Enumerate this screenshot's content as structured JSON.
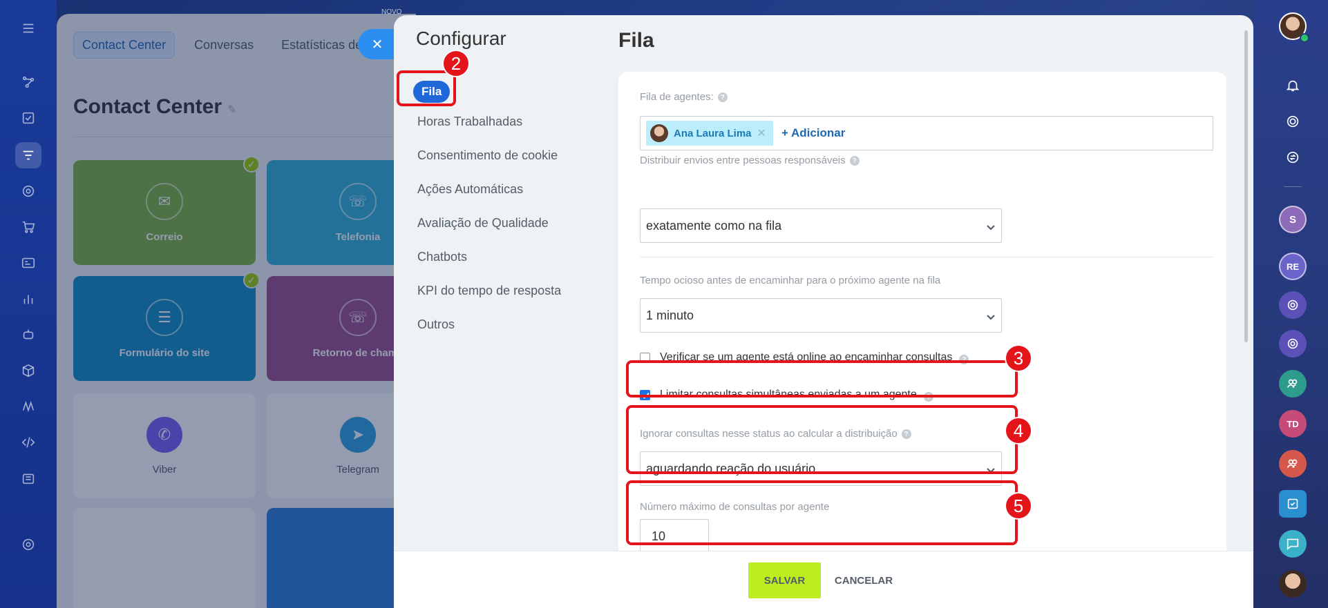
{
  "background_app": {
    "tabs": [
      "Contact Center",
      "Conversas",
      "Estatísticas de c"
    ],
    "novo_label": "NOVO",
    "title": "Contact Center",
    "tiles": [
      {
        "label": "Correio",
        "color": "#7db33c"
      },
      {
        "label": "Telefonia",
        "color": "#31b0d6"
      },
      {
        "label": "Formulário do site",
        "color": "#0f8fc2"
      },
      {
        "label": "Retorno de chama",
        "color": "#9a4f8b"
      },
      {
        "label": "Viber",
        "color": "#7360f2"
      },
      {
        "label": "Telegram",
        "color": "#2ba1dc"
      }
    ]
  },
  "settings": {
    "heading": "Configurar",
    "menu": [
      {
        "label": "Fila",
        "active": true
      },
      {
        "label": "Horas Trabalhadas"
      },
      {
        "label": "Consentimento de cookie"
      },
      {
        "label": "Ações Automáticas"
      },
      {
        "label": "Avaliação de Qualidade"
      },
      {
        "label": "Chatbots"
      },
      {
        "label": "KPI do tempo de resposta"
      },
      {
        "label": "Outros"
      }
    ],
    "page_title": "Fila",
    "agents_label": "Fila de agentes:",
    "agent_name": "Ana Laura Lima",
    "add_label": "+ Adicionar",
    "distribute_label": "Distribuir envios entre pessoas responsáveis",
    "distribute_value": "exatamente como na fila",
    "idle_label": "Tempo ocioso antes de encaminhar para o próximo agente na fila",
    "idle_value": "1 minuto",
    "check_online_label": "Verificar se um agente está online ao encaminhar consultas",
    "check_online": false,
    "limit_label": "Limitar consultas simultâneas enviadas a um agente",
    "limit_checked": true,
    "ignore_label": "Ignorar consultas nesse status ao calcular a distribuição",
    "ignore_value": "aguardando reação do usuário",
    "max_label": "Número máximo de consultas por agente",
    "max_value": "10",
    "save_label": "SALVAR",
    "cancel_label": "CANCELAR"
  },
  "annotations": [
    "2",
    "3",
    "4",
    "5"
  ],
  "right_rail": {
    "badges": [
      "S",
      "RE",
      "TD"
    ]
  },
  "colors": {
    "accent": "#2067d8",
    "save_button": "#bbed21",
    "annotation": "#e3151b"
  }
}
